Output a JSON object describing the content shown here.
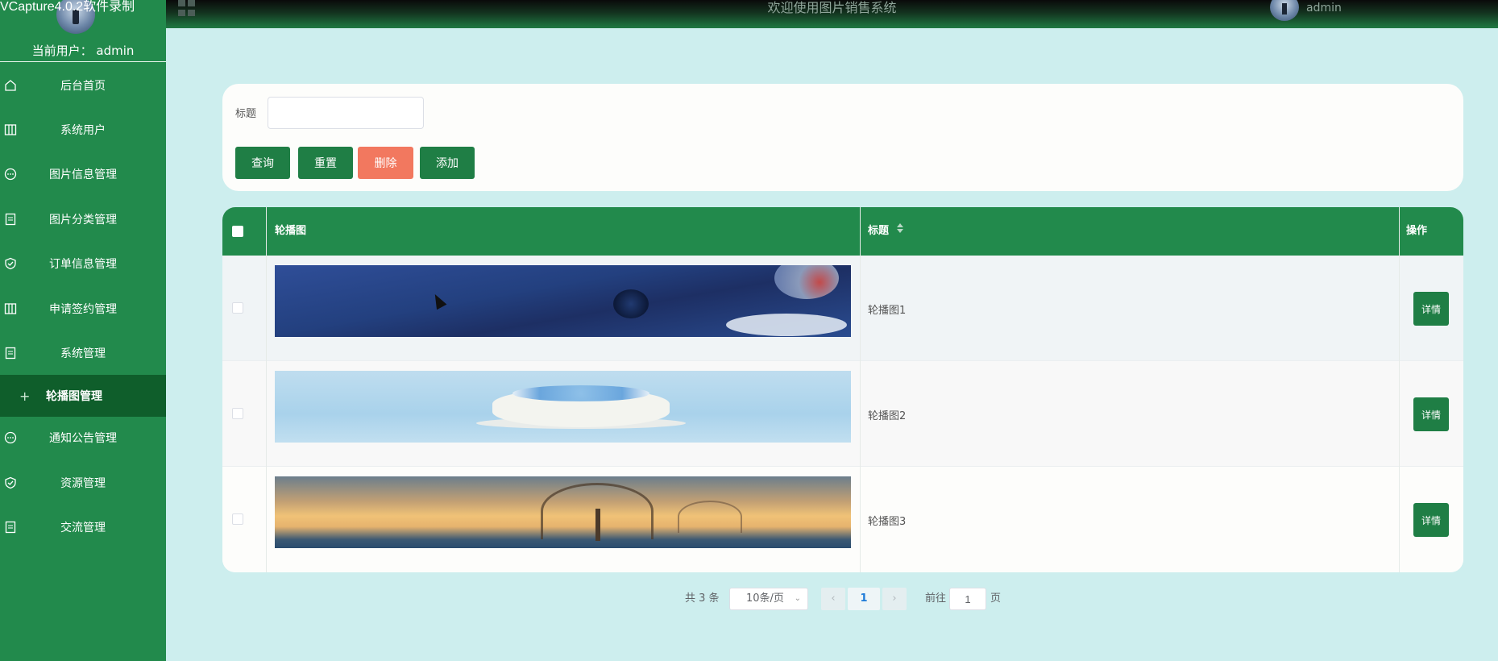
{
  "watermark": "VCapture4.0.2软件录制",
  "sidebar": {
    "current_user_label": "当前用户：",
    "current_user": "admin",
    "items": [
      {
        "label": "后台首页",
        "icon": "home-icon"
      },
      {
        "label": "系统用户",
        "icon": "columns-icon"
      },
      {
        "label": "图片信息管理",
        "icon": "chat-icon"
      },
      {
        "label": "图片分类管理",
        "icon": "document-icon"
      },
      {
        "label": "订单信息管理",
        "icon": "shield-check-icon"
      },
      {
        "label": "申请签约管理",
        "icon": "columns-icon"
      },
      {
        "label": "系统管理",
        "icon": "document-icon"
      },
      {
        "label": "轮播图管理",
        "icon": "plus-icon",
        "active": true
      },
      {
        "label": "通知公告管理",
        "icon": "chat-icon"
      },
      {
        "label": "资源管理",
        "icon": "shield-check-icon"
      },
      {
        "label": "交流管理",
        "icon": "document-icon"
      }
    ]
  },
  "topbar": {
    "title": "欢迎使用图片销售系统",
    "user": "admin"
  },
  "search": {
    "label": "标题",
    "value": "",
    "buttons": {
      "query": "查询",
      "reset": "重置",
      "delete": "删除",
      "add": "添加"
    }
  },
  "table": {
    "headers": {
      "image": "轮播图",
      "title": "标题",
      "action": "操作"
    },
    "rows": [
      {
        "title": "轮播图1",
        "action": "详情",
        "image": "hot-air-balloon-night-sky"
      },
      {
        "title": "轮播图2",
        "action": "详情",
        "image": "flower-cake-blue-sky"
      },
      {
        "title": "轮播图3",
        "action": "详情",
        "image": "foggy-trees-sunset"
      }
    ]
  },
  "pagination": {
    "total": "共 3 条",
    "page_size": "10条/页",
    "current_page": "1",
    "goto_label": "前往",
    "goto_value": "1",
    "page_suffix": "页"
  },
  "colors": {
    "sidebar": "#228a4c",
    "primary": "#1f7e45",
    "danger": "#f2785f",
    "background": "#cdeeee"
  }
}
